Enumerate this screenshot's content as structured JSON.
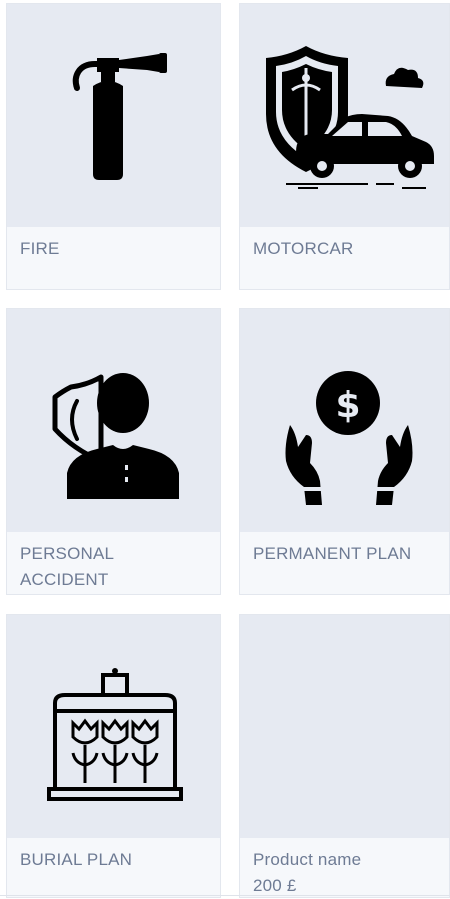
{
  "products": [
    {
      "label": "FIRE",
      "icon": "fire-extinguisher-icon"
    },
    {
      "label": "MOTORCAR",
      "icon": "car-insurance-icon"
    },
    {
      "label": "PERSONAL ACCIDENT",
      "icon": "personal-protection-icon"
    },
    {
      "label": "PERMANENT PLAN",
      "icon": "money-hands-icon"
    },
    {
      "label": "BURIAL PLAN",
      "icon": "burial-casket-icon"
    },
    {
      "label": "Product name",
      "price": "200 £",
      "icon": null
    }
  ],
  "colors": {
    "card_bg": "#f6f8fb",
    "media_bg": "#e6eaf2",
    "label": "#6e7b94",
    "border": "#e3e7ee"
  }
}
